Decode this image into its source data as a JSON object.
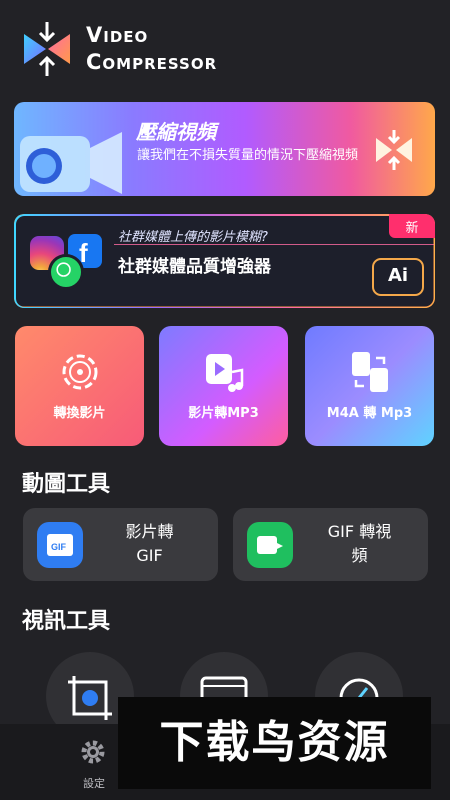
{
  "app": {
    "title_line1": "Video",
    "title_line2": "Compressor"
  },
  "compress_banner": {
    "title": "壓縮視頻",
    "subtitle": "讓我們在不損失質量的情況下壓縮視頻"
  },
  "social_banner": {
    "question": "社群媒體上傳的影片模糊?",
    "title": "社群媒體品質增強器",
    "badge": "新",
    "ai_label": "Ai"
  },
  "feature_cards": [
    {
      "label": "轉換影片",
      "icon": "film-reel-icon"
    },
    {
      "label": "影片轉MP3",
      "icon": "video-music-icon"
    },
    {
      "label": "M4A 轉 Mp3",
      "icon": "file-convert-icon"
    }
  ],
  "gif_section": {
    "heading": "動圖工具",
    "tools": [
      {
        "label": "影片轉\nGIF",
        "icon": "gif-icon",
        "color": "#2f7df2"
      },
      {
        "label": "GIF 轉視\n頻",
        "icon": "gif-to-video-icon",
        "color": "#1fbf5f"
      }
    ]
  },
  "video_section": {
    "heading": "視訊工具"
  },
  "bottom_nav": {
    "settings_label": "設定"
  },
  "watermark": {
    "text": "下载鸟资源"
  },
  "colors": {
    "background": "#222226",
    "badge": "#ff2f6d",
    "tool_bg": "#3a3a3e"
  }
}
